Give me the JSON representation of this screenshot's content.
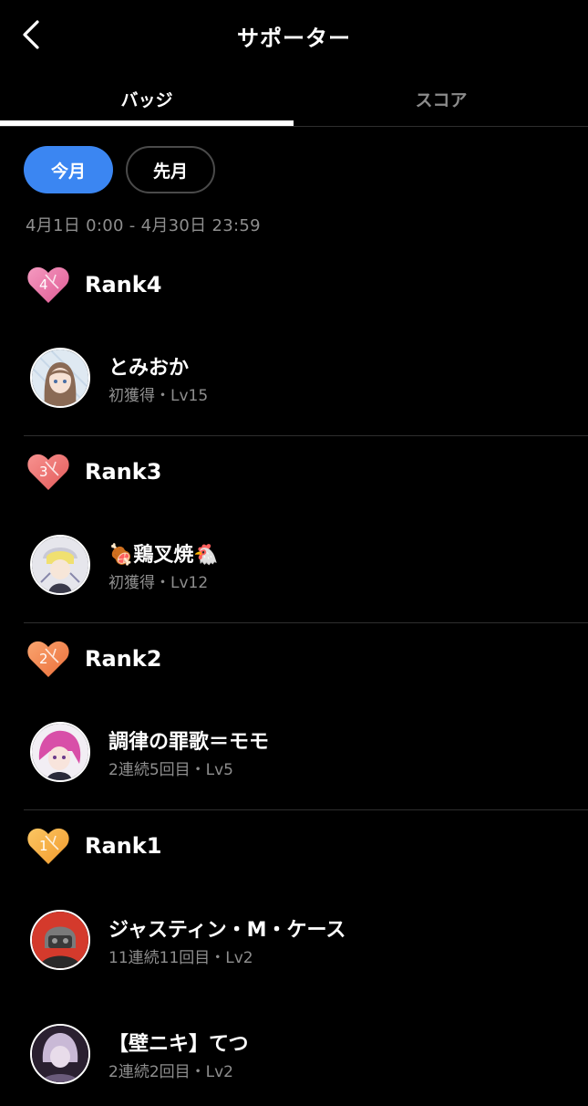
{
  "header": {
    "title": "サポーター",
    "back_icon": "chevron-left-icon"
  },
  "tabs": [
    {
      "label": "バッジ",
      "active": true
    },
    {
      "label": "スコア",
      "active": false
    }
  ],
  "filters": [
    {
      "label": "今月",
      "active": true
    },
    {
      "label": "先月",
      "active": false
    }
  ],
  "date_range": "4月1日 0:00 - 4月30日 23:59",
  "colors": {
    "accent": "#3b86f2",
    "rank4": "#e86aa0",
    "rank3": "#ef6f6c",
    "rank2": "#f2874d",
    "rank1": "#f5aa3c"
  },
  "ranks": [
    {
      "label": "Rank4",
      "badge_number": "4",
      "badge_icon": "heart-badge-icon",
      "users": [
        {
          "name": "とみおか",
          "sub": "初獲得・Lv15"
        }
      ]
    },
    {
      "label": "Rank3",
      "badge_number": "3",
      "badge_icon": "heart-badge-icon",
      "users": [
        {
          "name": "🍖鶏叉焼🐔",
          "sub": "初獲得・Lv12"
        }
      ]
    },
    {
      "label": "Rank2",
      "badge_number": "2",
      "badge_icon": "heart-badge-icon",
      "users": [
        {
          "name": "調律の罪歌＝モモ",
          "sub": "2連続5回目・Lv5"
        }
      ]
    },
    {
      "label": "Rank1",
      "badge_number": "1",
      "badge_icon": "heart-badge-icon",
      "users": [
        {
          "name": "ジャスティン・M・ケース",
          "sub": "11連続11回目・Lv2"
        },
        {
          "name": "【壁ニキ】てつ",
          "sub": "2連続2回目・Lv2"
        }
      ]
    }
  ]
}
